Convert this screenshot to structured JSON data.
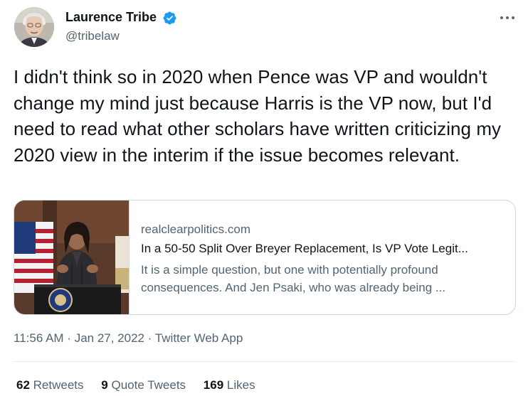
{
  "author": {
    "name": "Laurence Tribe",
    "handle": "@tribelaw",
    "verified": true
  },
  "icons": {
    "verified": "verified-badge-icon",
    "more": "more-options-icon"
  },
  "tweet": {
    "text": "I didn't think so in 2020 when Pence was VP and wouldn't change my mind just because Harris is the VP now, but I'd need to read what other scholars have written criticizing my 2020 view in the interim if the issue becomes relevant."
  },
  "card": {
    "domain": "realclearpolitics.com",
    "title": "In a 50-50 Split Over Breyer Replacement, Is VP Vote Legit...",
    "description": "It is a simple question, but one with potentially profound consequences. And Jen Psaki, who was already being ..."
  },
  "meta": {
    "time": "11:56 AM",
    "separator1": " · ",
    "date": "Jan 27, 2022",
    "separator2": " · ",
    "app": "Twitter Web App"
  },
  "stats": [
    {
      "count": "62",
      "label": "Retweets"
    },
    {
      "count": "9",
      "label": "Quote Tweets"
    },
    {
      "count": "169",
      "label": "Likes"
    }
  ],
  "colors": {
    "text": "#0f1419",
    "secondary": "#536471",
    "border": "#cfd9de",
    "verified": "#1d9bf0"
  }
}
